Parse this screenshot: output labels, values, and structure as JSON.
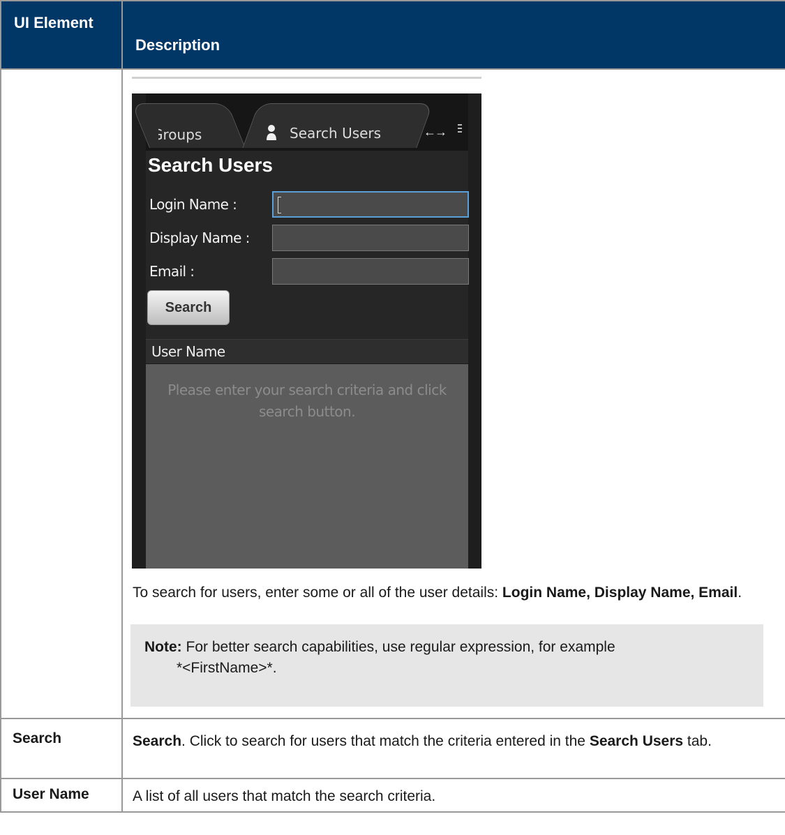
{
  "table": {
    "header": {
      "element": "UI Element",
      "description": "Description"
    },
    "rows": [
      {
        "element": "",
        "screenshot": {
          "tab_groups": "Groups",
          "tab_search": "Search Users",
          "panel_title": "Search Users",
          "fields": [
            {
              "label": "Login Name :",
              "value": ""
            },
            {
              "label": "Display Name :",
              "value": ""
            },
            {
              "label": "Email :",
              "value": ""
            }
          ],
          "search_button": "Search",
          "grid_header": "User Name",
          "grid_empty_line1": "Please enter your search criteria and click",
          "grid_empty_line2": "search button."
        },
        "desc_text": "To search for users, enter some or all of the user details: ",
        "desc_bold": "Login Name, Display Name, Email",
        "desc_end": ".",
        "note_label": "Note:",
        "note_text_1": " For better search capabilities, use regular expression, for example",
        "note_text_2": "*<FirstName>*."
      },
      {
        "element": "Search",
        "desc_bold_1": "Search",
        "desc_text_1": ". Click to search for users that match the criteria entered in the ",
        "desc_bold_2": "Search Users",
        "desc_text_2": " tab."
      },
      {
        "element": "User Name",
        "desc_text": "A list of all users that match the search criteria."
      }
    ]
  },
  "colors": {
    "header_bg": "#003767",
    "border": "#999999",
    "note_bg": "#e6e6e6",
    "input_focus": "#5a9fd8"
  },
  "icons": [
    "user-icon",
    "arrows-icon",
    "menu-icon"
  ]
}
